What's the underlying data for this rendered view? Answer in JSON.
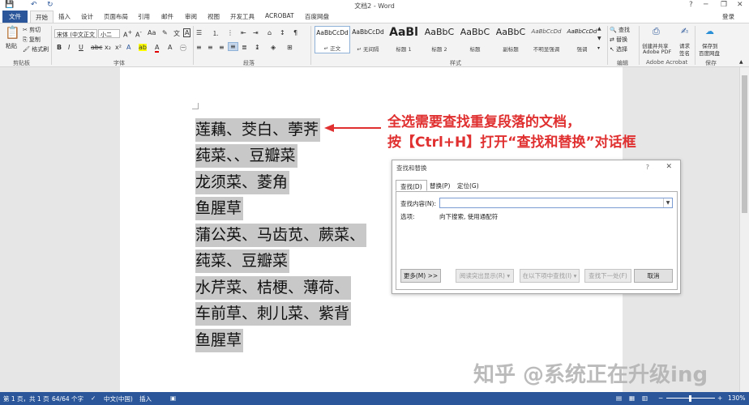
{
  "window": {
    "title": "文档2 - Word",
    "help": "?",
    "min": "─",
    "restore": "❐",
    "close": "✕",
    "qa_save": "💾",
    "qa_undo": "↶",
    "qa_redo": "↻"
  },
  "tabs": [
    "文件",
    "开始",
    "插入",
    "设计",
    "页面布局",
    "引用",
    "邮件",
    "审阅",
    "视图",
    "开发工具",
    "ACROBAT",
    "百度网盘"
  ],
  "login": "登录",
  "ribbon": {
    "clipboard": {
      "paste": "粘贴",
      "cut": "剪切",
      "copy": "复制",
      "format_painter": "格式刷",
      "label": "剪贴板"
    },
    "font": {
      "name": "宋体 (中文正文",
      "size": "小二",
      "label": "字体"
    },
    "paragraph": {
      "label": "段落"
    },
    "styles": {
      "label": "样式",
      "items": [
        {
          "sample": "AaBbCcDd",
          "name": "↵ 正文"
        },
        {
          "sample": "AaBbCcDd",
          "name": "↵ 无间隔"
        },
        {
          "sample": "AaBl",
          "name": "标题 1"
        },
        {
          "sample": "AaBbC",
          "name": "标题 2"
        },
        {
          "sample": "AaBbC",
          "name": "标题"
        },
        {
          "sample": "AaBbC",
          "name": "副标题"
        },
        {
          "sample": "AaBbCcDd",
          "name": "不明显强调"
        },
        {
          "sample": "AaBbCcDd",
          "name": "强调"
        }
      ]
    },
    "editing": {
      "find": "查找",
      "replace": "替换",
      "select": "选择",
      "label": "编辑"
    },
    "acrobat": {
      "create_share": "创建并共享",
      "adobe_pdf": "Adobe PDF",
      "request": "请求",
      "sign": "签名",
      "label": "Adobe Acrobat"
    },
    "save": {
      "save_to": "保存到",
      "baidu": "百度网盘",
      "label": "保存"
    }
  },
  "document": {
    "paragraphs": [
      "莲藕、茭白、荸荠",
      "莼菜、、豆瓣菜",
      "龙须菜、菱角",
      "鱼腥草",
      "蒲公英、马齿苋、蕨菜、",
      "莼菜、豆瓣菜",
      "水芹菜、桔梗、薄荷、",
      "车前草、刺儿菜、紫背",
      "鱼腥草"
    ]
  },
  "annotation": {
    "line1": "全选需要查找重复段落的文档，",
    "line2": "按【Ctrl+H】打开“查找和替换”对话框"
  },
  "dialog": {
    "title": "查找和替换",
    "help": "?",
    "close": "✕",
    "tabs": [
      "查找(D)",
      "替换(P)",
      "定位(G)"
    ],
    "find_label": "查找内容(N):",
    "find_value": "",
    "options_label": "选项:",
    "options_value": "向下搜索, 使用通配符",
    "buttons": {
      "more": "更多(M) >>",
      "highlight": "阅读突出显示(R) ▾",
      "find_in": "在以下项中查找(I) ▾",
      "find_next": "查找下一处(F)",
      "cancel": "取消"
    }
  },
  "statusbar": {
    "page": "第 1 页，共 1 页",
    "words": "64/64 个字",
    "lang": "中文(中国)",
    "mode": "插入",
    "zoom": "130%"
  },
  "watermark": "知乎 @系统正在升级ing"
}
